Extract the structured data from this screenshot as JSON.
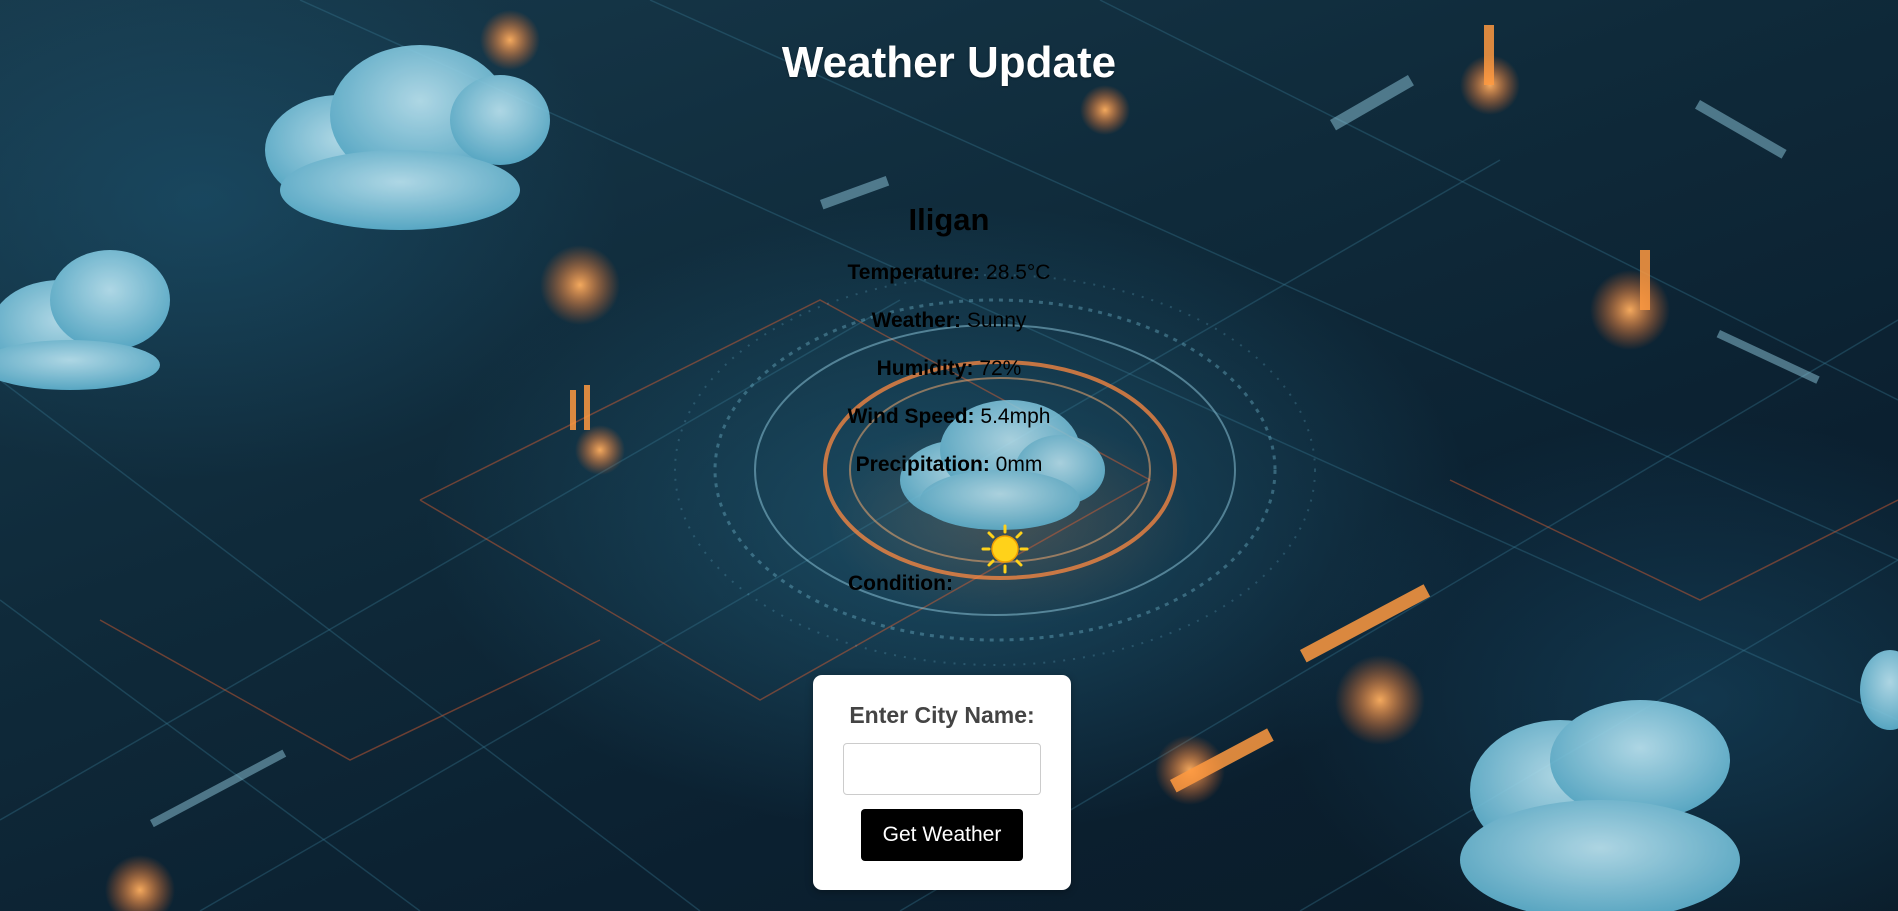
{
  "page": {
    "title": "Weather Update"
  },
  "weather": {
    "city": "Iligan",
    "temperature": {
      "label": "Temperature:",
      "value": "28.5°C"
    },
    "condition_text": {
      "label": "Weather:",
      "value": "Sunny"
    },
    "humidity": {
      "label": "Humidity:",
      "value": "72%"
    },
    "wind_speed": {
      "label": "Wind Speed:",
      "value": "5.4mph"
    },
    "precipitation": {
      "label": "Precipitation:",
      "value": "0mm"
    },
    "condition": {
      "label": "Condition:",
      "icon": "sun-icon"
    }
  },
  "search": {
    "label": "Enter City Name:",
    "input_value": "",
    "input_placeholder": "",
    "button_label": "Get Weather"
  },
  "colors": {
    "title_text": "#ffffff",
    "card_background": "#ffffff",
    "button_background": "#000000",
    "button_text": "#ffffff",
    "sun_yellow": "#ffd21a"
  }
}
